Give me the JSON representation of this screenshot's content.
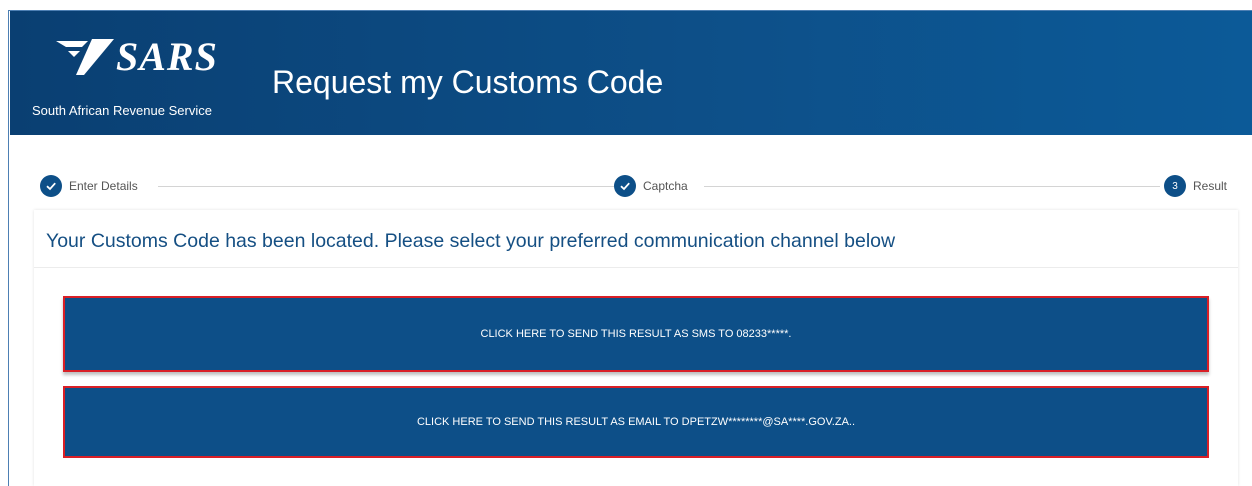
{
  "header": {
    "logo_text": "SARS",
    "org_name": "South African Revenue Service",
    "title": "Request my Customs Code"
  },
  "stepper": {
    "steps": [
      {
        "label": "Enter Details",
        "state": "complete",
        "marker": "✓"
      },
      {
        "label": "Captcha",
        "state": "complete",
        "marker": "✓"
      },
      {
        "label": "Result",
        "state": "current",
        "marker": "3"
      }
    ]
  },
  "result": {
    "message": "Your Customs Code has been located. Please select your preferred communication channel below",
    "sms_button": "CLICK HERE TO SEND THIS RESULT AS SMS TO 08233*****.",
    "email_button": "CLICK HERE TO SEND THIS RESULT AS EMAIL TO DPETZW********@SA****.GOV.ZA.."
  },
  "colors": {
    "brand_blue": "#0d4f88",
    "highlight_red": "#d91f26",
    "message_text": "#154f83"
  },
  "icons": {
    "step_complete": "check-circle-icon",
    "logo_mark": "sars-arrow-icon"
  }
}
